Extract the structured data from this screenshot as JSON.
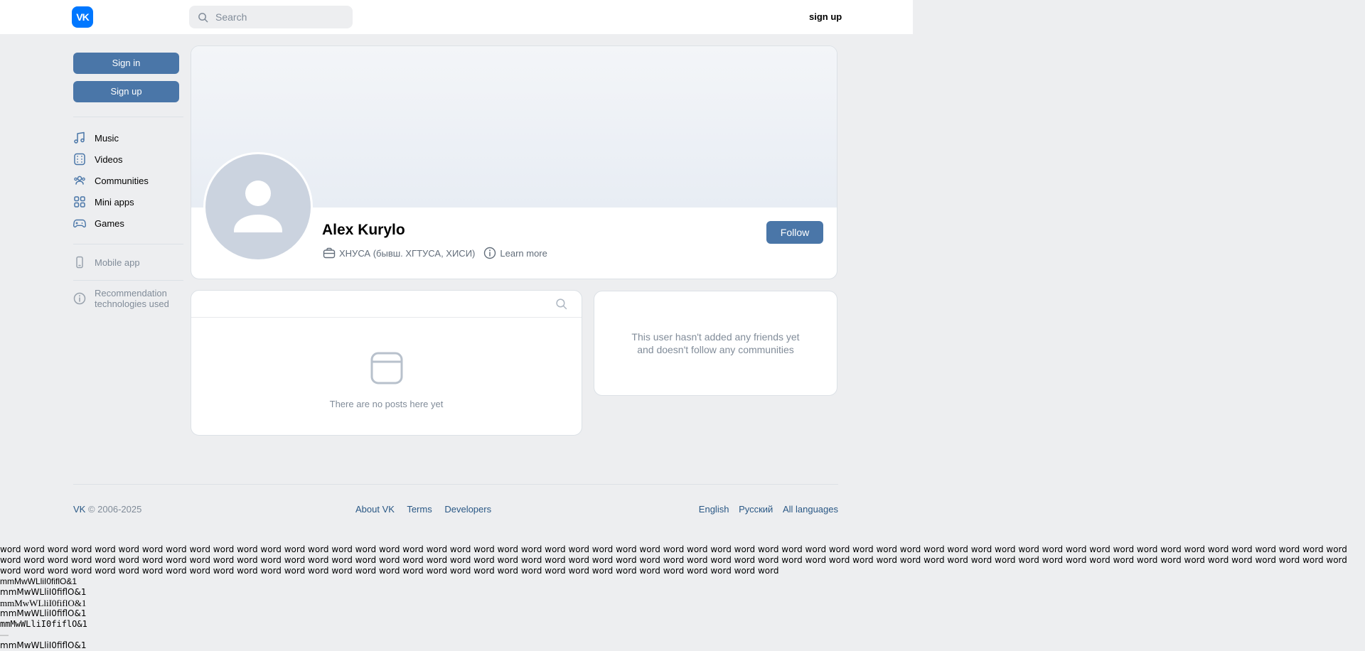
{
  "header": {
    "logo_text": "VK",
    "search_placeholder": "Search",
    "signup_label": "sign up"
  },
  "sidebar": {
    "sign_in": "Sign in",
    "sign_up": "Sign up",
    "items": [
      {
        "label": "Music",
        "icon": "music-icon"
      },
      {
        "label": "Videos",
        "icon": "video-icon"
      },
      {
        "label": "Communities",
        "icon": "communities-icon"
      },
      {
        "label": "Mini apps",
        "icon": "mini-apps-icon"
      },
      {
        "label": "Games",
        "icon": "gamepad-icon"
      }
    ],
    "mobile_app": "Mobile app",
    "rec_line1": "Recommendation",
    "rec_line2": "technologies used"
  },
  "profile": {
    "name": "Alex Kurylo",
    "work": "ХНУСА (бывш. ХГТУСА, ХИСИ)",
    "learn_more": "Learn more",
    "follow": "Follow"
  },
  "posts": {
    "empty": "There are no posts here yet"
  },
  "friends": {
    "line1": "This user hasn't added any friends yet",
    "line2": "and doesn't follow any communities"
  },
  "footer": {
    "brand": "VK",
    "copyright": "© 2006-2025",
    "links": [
      "About VK",
      "Terms",
      "Developers"
    ],
    "languages": [
      "English",
      "Русский",
      "All languages"
    ]
  },
  "font_test": {
    "words_line": "word word word word word word word word word word word word word word word word word word word word word word word word word word word word word word word word word word word word word word word word word word word word word word word word word word word word word word word word word word word word word word word word word word word word word word word word word word word word word word word word word word word word word word word word word word word word word word word word word word word word word word word word word word word word word word word word word word word word word word word word word word word word word word word word word word word word word word word word word word word word word word word word word word word",
    "samples": [
      "mmMwWLliI0fiflO&1",
      "mmMwWLliI0fiflO&1",
      "mmMwWLliI0fiflO&1",
      "mmMwWLliI0fiflO&1",
      "mmMwWLliI0fiflO&1",
      "mmMwWLliI0fiflO&1"
    ],
    "dash": "—"
  }
}
